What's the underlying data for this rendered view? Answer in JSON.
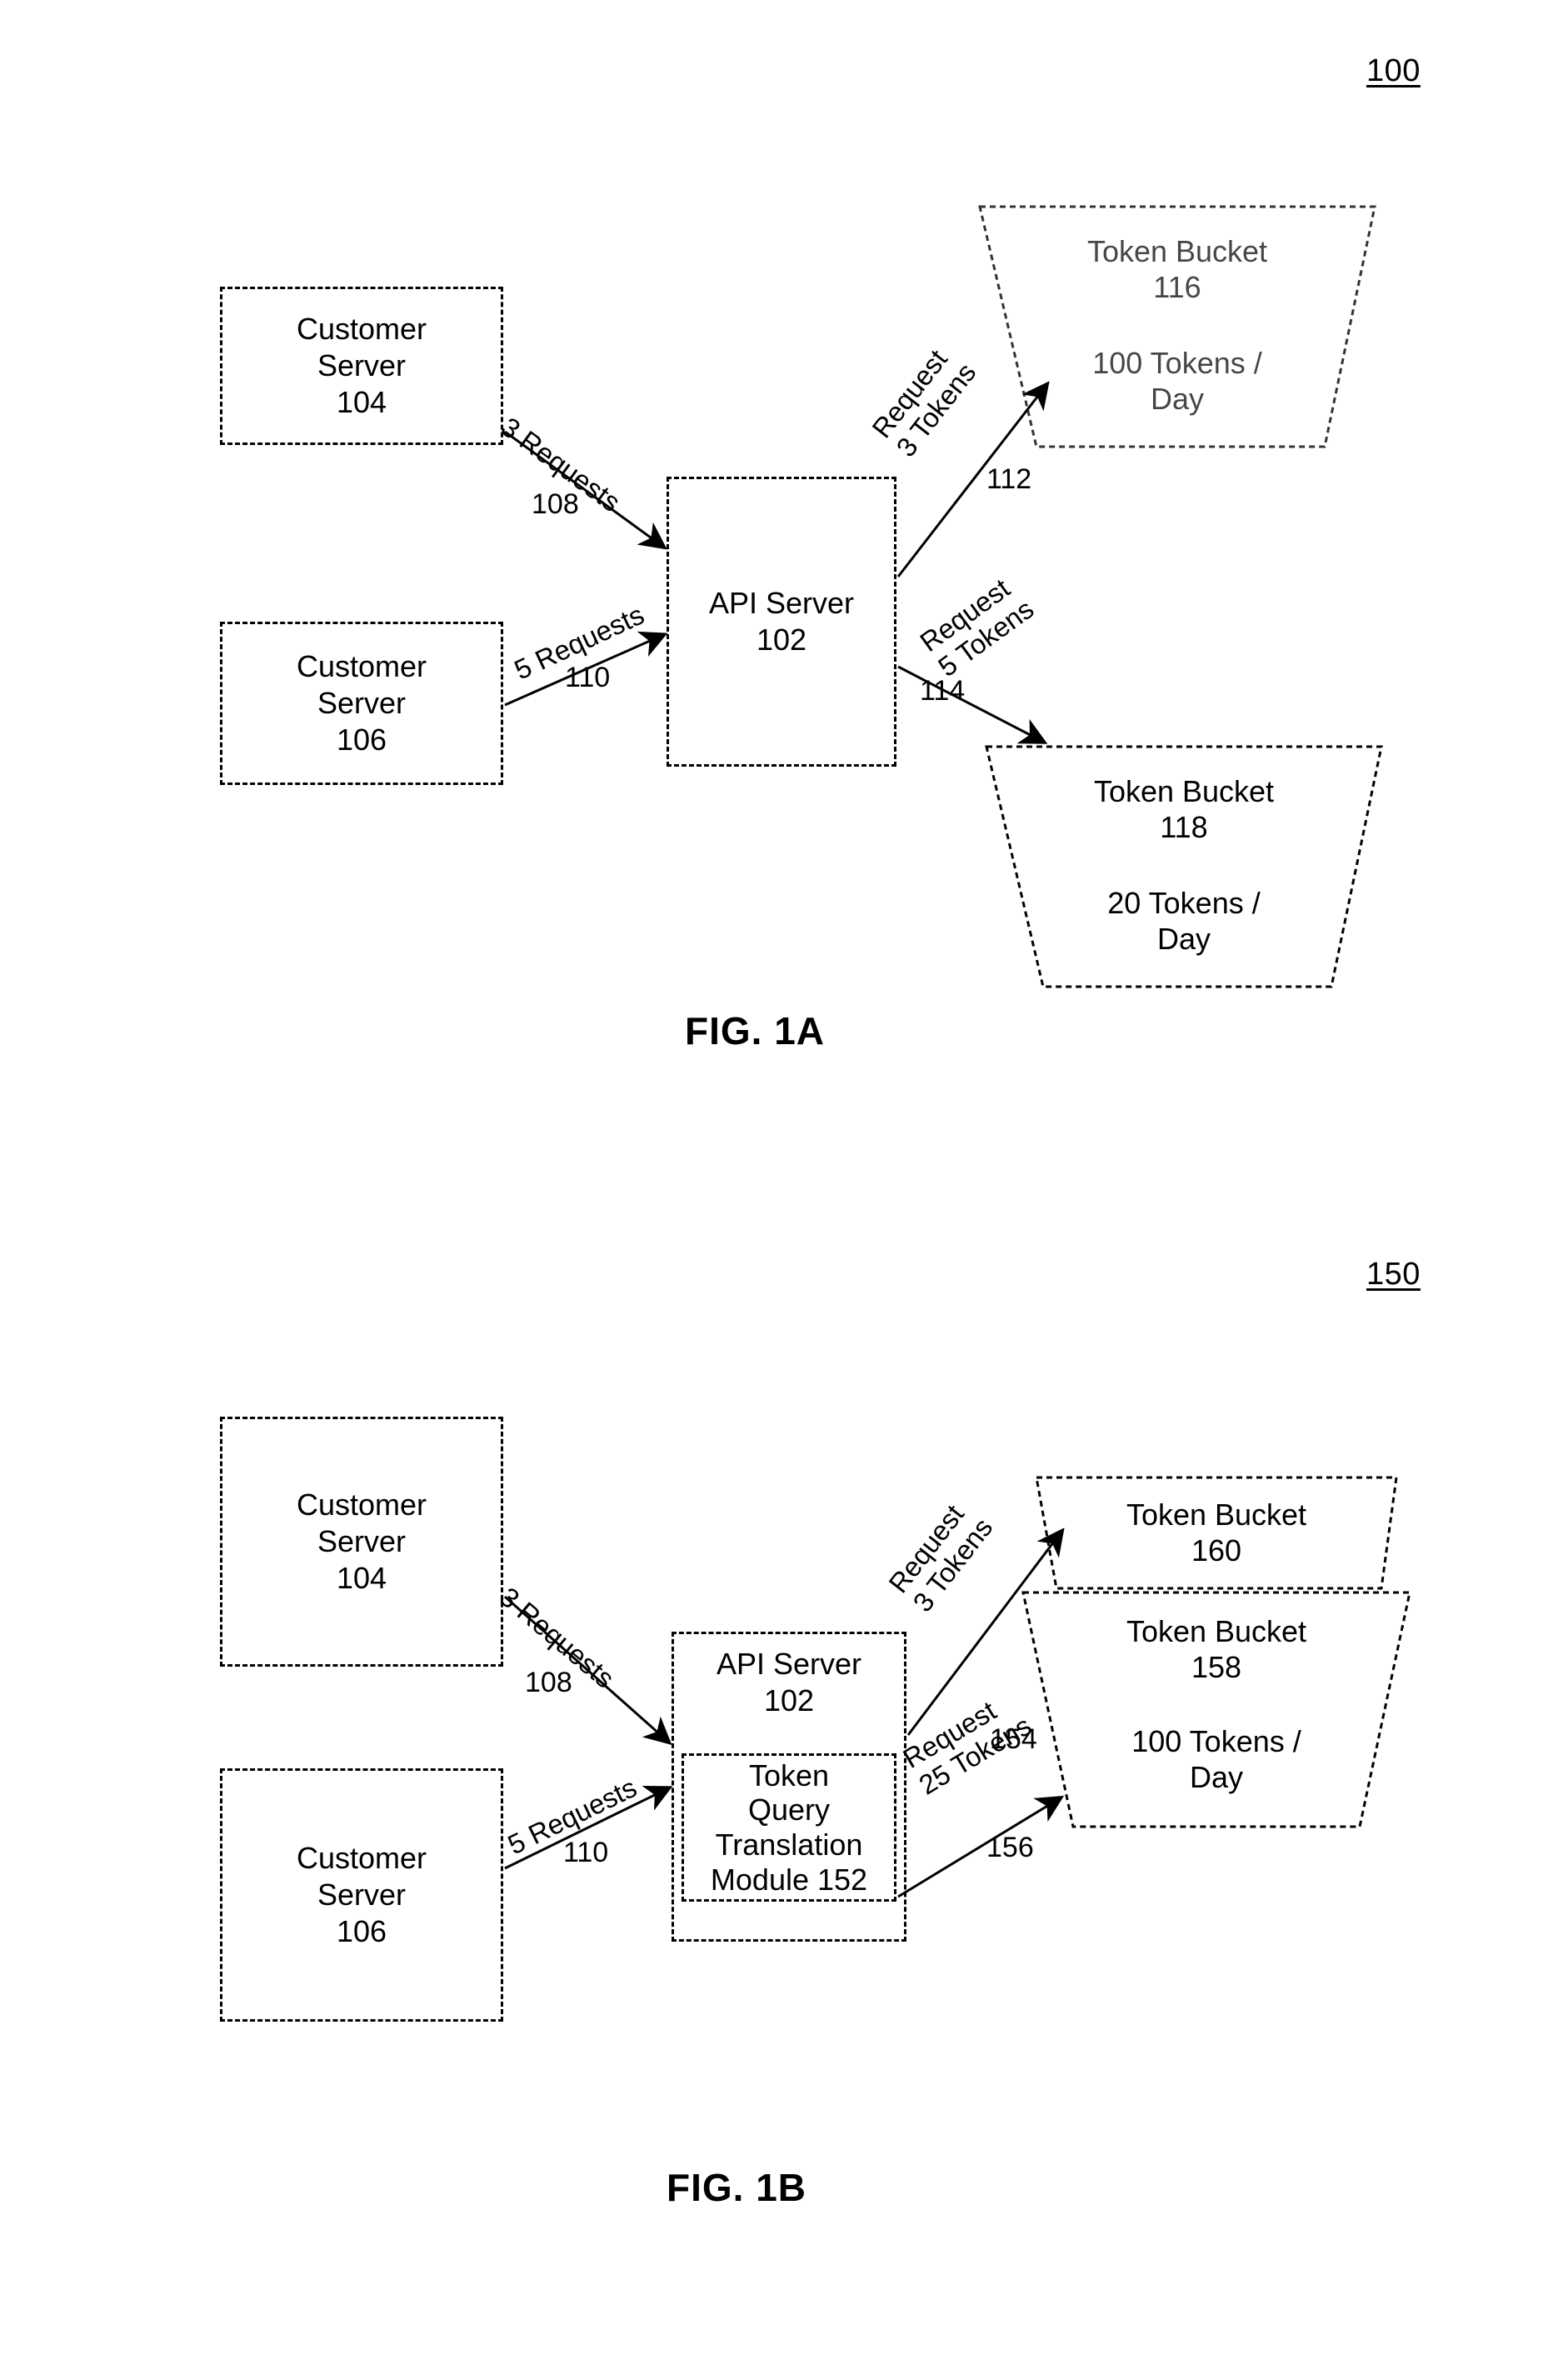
{
  "page": {
    "background": "#ffffff",
    "ink": "#000000"
  },
  "figures": [
    {
      "id": "fig-1a",
      "ref_numeral": "100",
      "caption": "FIG. 1A",
      "nodes": {
        "customer_server_104": "Customer\nServer\n104",
        "customer_server_106": "Customer\nServer\n106",
        "api_server_102": "API Server\n102",
        "token_bucket_116_title": "Token Bucket\n116",
        "token_bucket_116_rate": "100 Tokens /\nDay",
        "token_bucket_118_title": "Token Bucket\n118",
        "token_bucket_118_rate": "20 Tokens /\nDay"
      },
      "edges": [
        {
          "id": "edge-108",
          "label": "3 Requests",
          "numeral": "108",
          "from": "customer_server_104",
          "to": "api_server_102"
        },
        {
          "id": "edge-110",
          "label": "5 Requests",
          "numeral": "110",
          "from": "customer_server_106",
          "to": "api_server_102"
        },
        {
          "id": "edge-112",
          "label": "Request\n3 Tokens",
          "numeral": "112",
          "from": "api_server_102",
          "to": "token_bucket_116"
        },
        {
          "id": "edge-114",
          "label": "Request\n5 Tokens",
          "numeral": "114",
          "from": "api_server_102",
          "to": "token_bucket_118"
        }
      ]
    },
    {
      "id": "fig-1b",
      "ref_numeral": "150",
      "caption": "FIG. 1B",
      "nodes": {
        "customer_server_104": "Customer\nServer\n104",
        "customer_server_106": "Customer\nServer\n106",
        "api_server_102": "API Server\n102",
        "token_query_translation_module_152": "Token\nQuery\nTranslation\nModule 152",
        "token_bucket_160_title": "Token Bucket\n160",
        "token_bucket_158_title": "Token Bucket\n158",
        "token_bucket_158_rate": "100 Tokens /\nDay"
      },
      "edges": [
        {
          "id": "edge-108",
          "label": "3 Requests",
          "numeral": "108",
          "from": "customer_server_104",
          "to": "api_server_102"
        },
        {
          "id": "edge-110",
          "label": "5 Requests",
          "numeral": "110",
          "from": "customer_server_106",
          "to": "api_server_102"
        },
        {
          "id": "edge-154",
          "label": "Request\n3 Tokens",
          "numeral": "154",
          "from": "api_server_102",
          "to": "token_bucket_160"
        },
        {
          "id": "edge-156",
          "label": "Request\n25 Tokens",
          "numeral": "156",
          "from": "token_query_translation_module_152",
          "to": "token_bucket_158"
        }
      ]
    }
  ]
}
